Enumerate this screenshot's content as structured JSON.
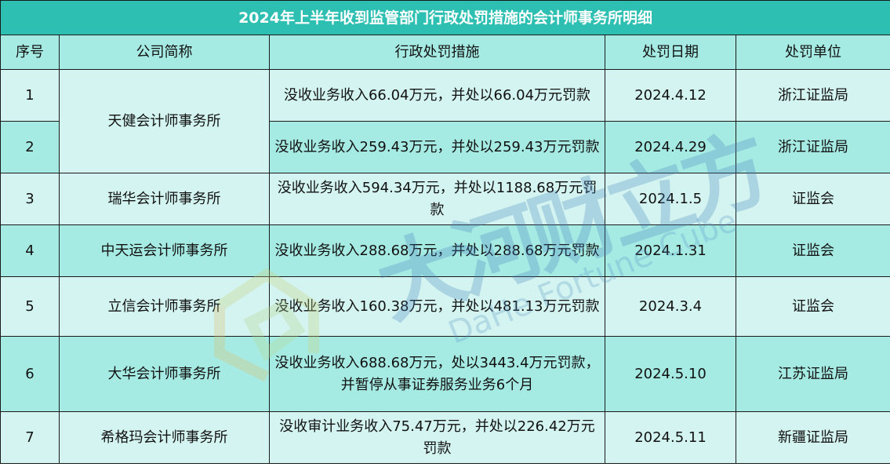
{
  "title": "2024年上半年收到监管部门行政处罚措施的会计师事务所明细",
  "headers": [
    "序号",
    "公司简称",
    "行政处罚措施",
    "处罚日期",
    "处罚单位"
  ],
  "rows": [
    {
      "no": "1",
      "company": "天健会计师事务所",
      "measure": "没收业务收入66.04万元，并处以66.04万元罚款",
      "date": "2024.4.12",
      "unit": "浙江证监局"
    },
    {
      "no": "2",
      "company": "天健会计师事务所",
      "measure": "没收业务收入259.43万元，并处以259.43万元罚款",
      "date": "2024.4.29",
      "unit": "浙江证监局"
    },
    {
      "no": "3",
      "company": "瑞华会计师事务所",
      "measure": "没收业务收入594.34万元，并处以1188.68万元罚款",
      "date": "2024.1.5",
      "unit": "证监会"
    },
    {
      "no": "4",
      "company": "中天运会计师事务所",
      "measure": "没收业务收入288.68万元，并处以288.68万元罚款",
      "date": "2024.1.31",
      "unit": "证监会"
    },
    {
      "no": "5",
      "company": "立信会计师事务所",
      "measure": "没收业务收入160.38万元，并处以481.13万元罚款",
      "date": "2024.3.4",
      "unit": "证监会"
    },
    {
      "no": "6",
      "company": "大华会计师事务所",
      "measure": "没收业务收入688.68万元，处以3443.4万元罚款，并暂停从事证券服务业务6个月",
      "date": "2024.5.10",
      "unit": "江苏证监局"
    },
    {
      "no": "7",
      "company": "希格玛会计师事务所",
      "measure": "没收审计业务收入75.47万元，并处以226.42万元罚款",
      "date": "2024.5.11",
      "unit": "新疆证监局"
    }
  ],
  "watermark": {
    "cn": "大河财立方",
    "en": "DaHe Fortune Cube"
  },
  "colors": {
    "title_bg": "#2ebfb3",
    "header_bg": "#a6ebe3",
    "row_light": "#d3f4f0",
    "row_dark": "#a6ebe3"
  }
}
